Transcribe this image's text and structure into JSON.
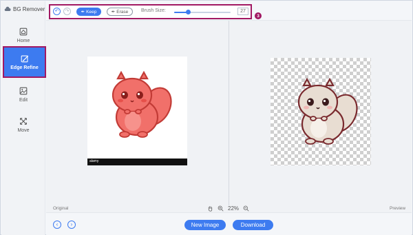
{
  "app": {
    "title": "BG Remover"
  },
  "sidebar": {
    "items": [
      {
        "label": "Home",
        "icon": "home-icon"
      },
      {
        "label": "Edge Refine",
        "icon": "edge-refine-icon",
        "active": true
      },
      {
        "label": "Edit",
        "icon": "edit-image-icon"
      },
      {
        "label": "Move",
        "icon": "move-icon"
      }
    ],
    "badge": "2"
  },
  "toolbar": {
    "keep_label": "Keep",
    "erase_label": "Erase",
    "brush_label": "Brush Size:",
    "brush_value": "27",
    "brush_level": 0.25,
    "badge": "3"
  },
  "canvas": {
    "original_label": "Original",
    "preview_label": "Preview",
    "zoom": "22%",
    "watermark": "alamy"
  },
  "footer": {
    "new_image_label": "New Image",
    "download_label": "Download"
  },
  "colors": {
    "accent": "#3d7bf0",
    "highlight": "#a11862",
    "squirrel_original": "#f1706a",
    "squirrel_preview": "#e8ddd2"
  }
}
